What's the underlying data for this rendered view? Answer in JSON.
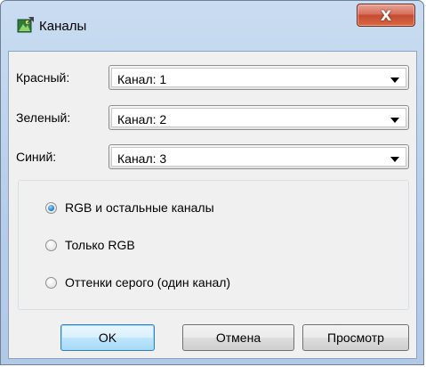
{
  "window": {
    "title": "Каналы",
    "close_glyph": "X",
    "icon": "app-channels-icon"
  },
  "channels": [
    {
      "label": "Красный:",
      "value": "Канал: 1"
    },
    {
      "label": "Зеленый:",
      "value": "Канал: 2"
    },
    {
      "label": "Синий:",
      "value": "Канал: 3"
    }
  ],
  "mode_options": [
    {
      "label": "RGB и остальные каналы",
      "selected": true
    },
    {
      "label": "Только RGB",
      "selected": false
    },
    {
      "label": "Оттенки серого (один канал)",
      "selected": false
    }
  ],
  "buttons": {
    "ok": "OK",
    "cancel": "Отмена",
    "preview": "Просмотр"
  },
  "colors": {
    "title_bar": "#b9cfea",
    "close_button": "#c7503a",
    "radio_selected": "#2a7fd4"
  }
}
